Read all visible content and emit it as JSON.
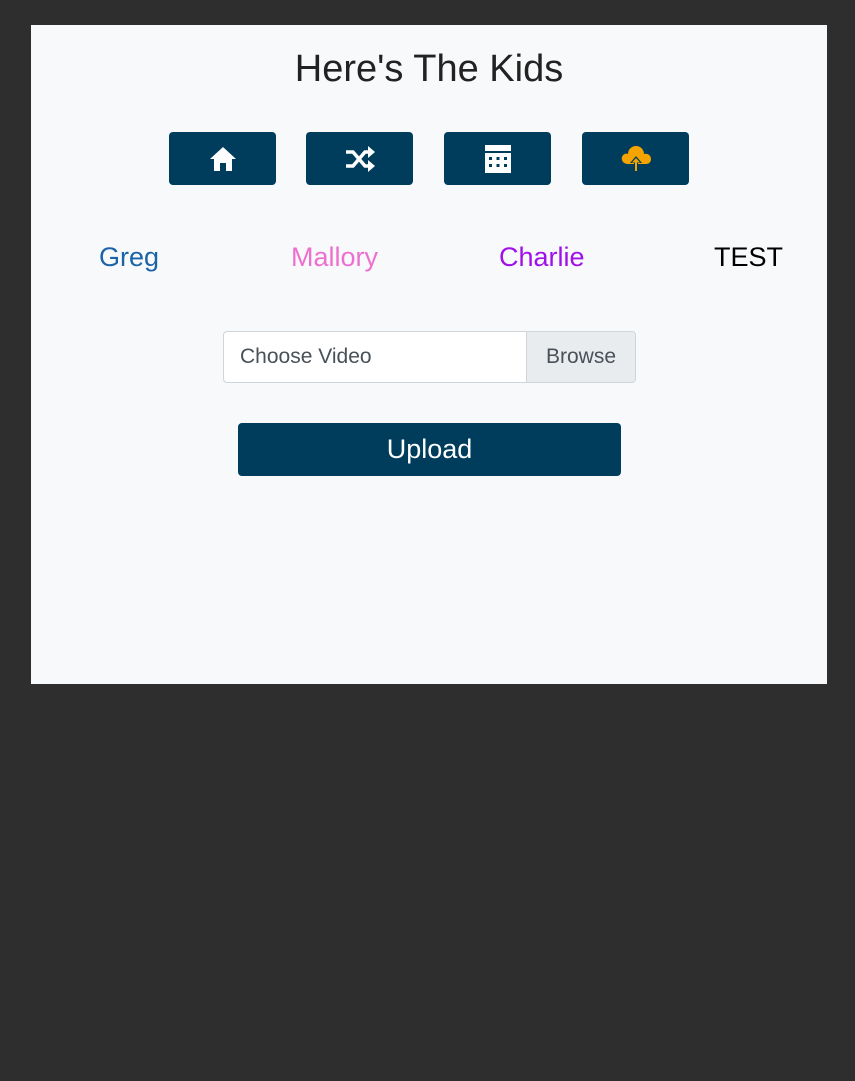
{
  "page": {
    "title": "Here's The Kids"
  },
  "nav": {
    "buttons": [
      {
        "icon": "home-icon",
        "color": "#ffffff"
      },
      {
        "icon": "shuffle-icon",
        "color": "#ffffff"
      },
      {
        "icon": "calendar-icon",
        "color": "#ffffff"
      },
      {
        "icon": "cloud-upload-icon",
        "color": "#f5a300"
      }
    ],
    "button_color": "#003d5c"
  },
  "kids": [
    {
      "name": "Greg",
      "color": "#1c63a8"
    },
    {
      "name": "Mallory",
      "color": "#ee6fcf"
    },
    {
      "name": "Charlie",
      "color": "#a010e8"
    },
    {
      "name": "TEST",
      "color": "#000000"
    }
  ],
  "upload_form": {
    "file_placeholder": "Choose Video",
    "browse_label": "Browse",
    "submit_label": "Upload"
  },
  "colors": {
    "background": "#2e2e2e",
    "card": "#f8f9fb",
    "accent": "#003d5c"
  }
}
